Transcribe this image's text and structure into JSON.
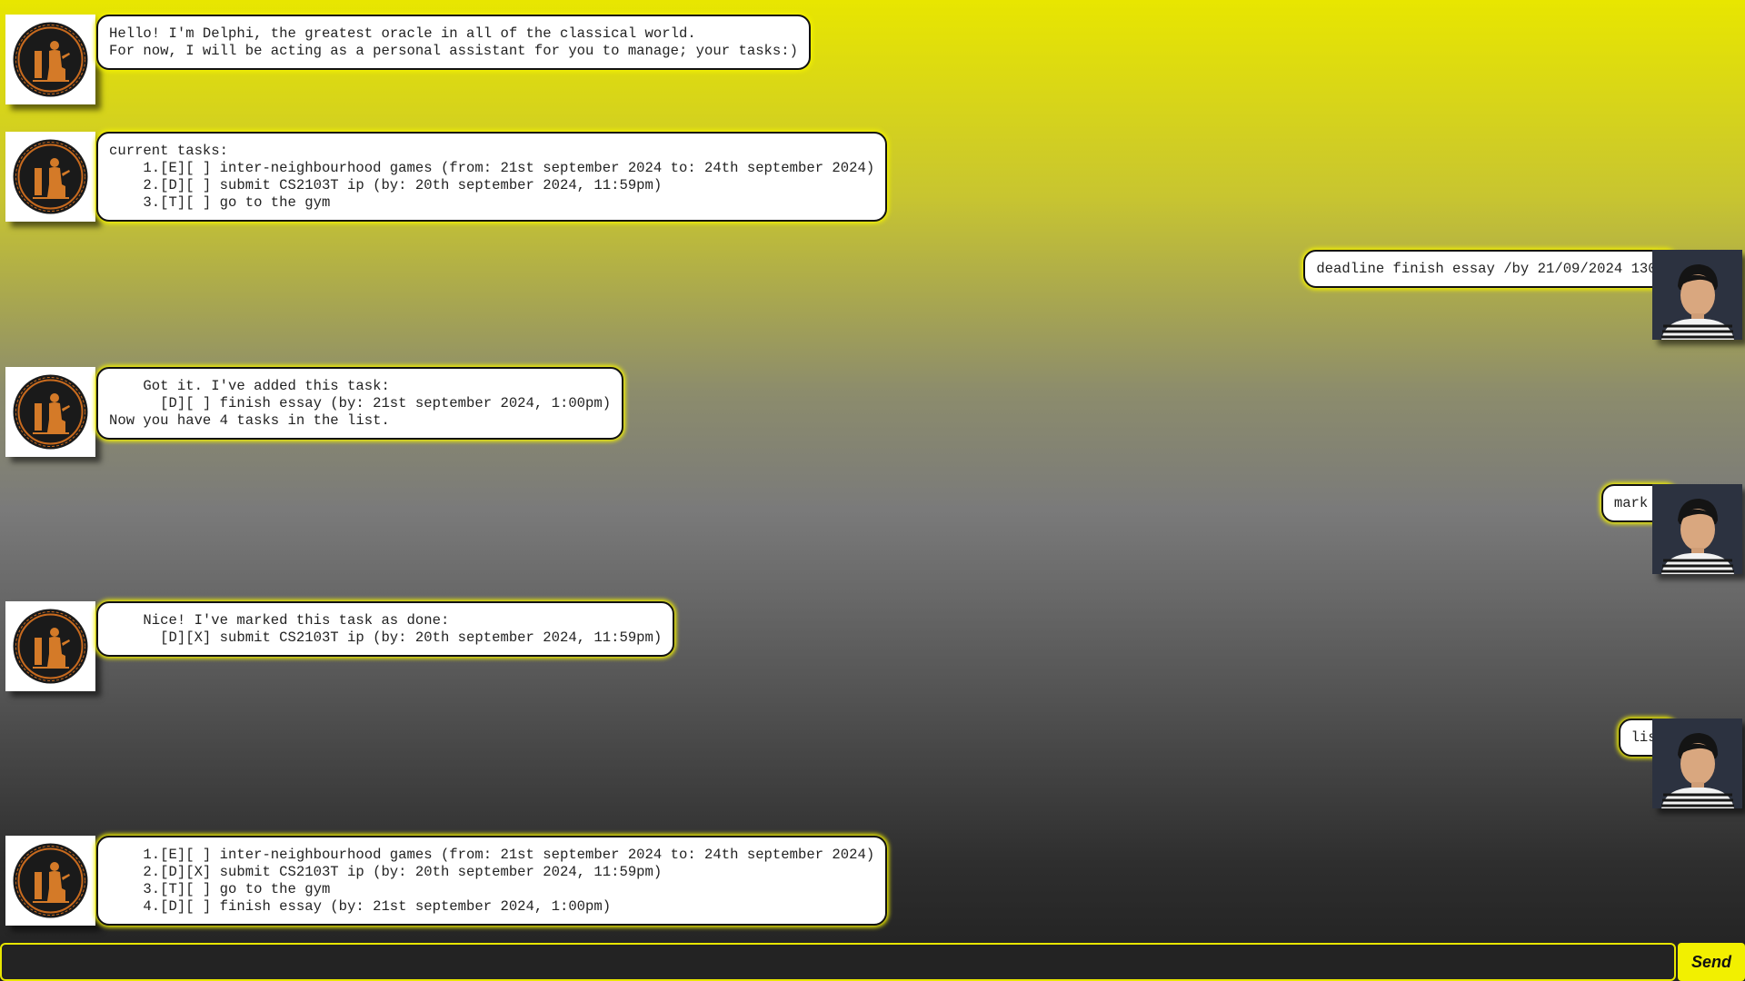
{
  "colors": {
    "accent": "#f2f000",
    "bubble_background": "#ffffff",
    "input_background": "#232323"
  },
  "icons": {
    "bot": "oracle-vase-icon",
    "user": "user-avatar-icon"
  },
  "messages": [
    {
      "sender": "bot",
      "text": "Hello! I'm Delphi, the greatest oracle in all of the classical world.\nFor now, I will be acting as a personal assistant for you to manage; your tasks:)"
    },
    {
      "sender": "bot",
      "text": "current tasks:\n    1.[E][ ] inter-neighbourhood games (from: 21st september 2024 to: 24th september 2024)\n    2.[D][ ] submit CS2103T ip (by: 20th september 2024, 11:59pm)\n    3.[T][ ] go to the gym"
    },
    {
      "sender": "user",
      "text": "deadline finish essay /by 21/09/2024 1300"
    },
    {
      "sender": "bot",
      "text": "    Got it. I've added this task:\n      [D][ ] finish essay (by: 21st september 2024, 1:00pm)\nNow you have 4 tasks in the list."
    },
    {
      "sender": "user",
      "text": "mark 2"
    },
    {
      "sender": "bot",
      "text": "    Nice! I've marked this task as done:\n      [D][X] submit CS2103T ip (by: 20th september 2024, 11:59pm)"
    },
    {
      "sender": "user",
      "text": "list"
    },
    {
      "sender": "bot",
      "text": "    1.[E][ ] inter-neighbourhood games (from: 21st september 2024 to: 24th september 2024)\n    2.[D][X] submit CS2103T ip (by: 20th september 2024, 11:59pm)\n    3.[T][ ] go to the gym\n    4.[D][ ] finish essay (by: 21st september 2024, 1:00pm)"
    }
  ],
  "input": {
    "value": "",
    "placeholder": ""
  },
  "send_button": {
    "label": "Send"
  }
}
